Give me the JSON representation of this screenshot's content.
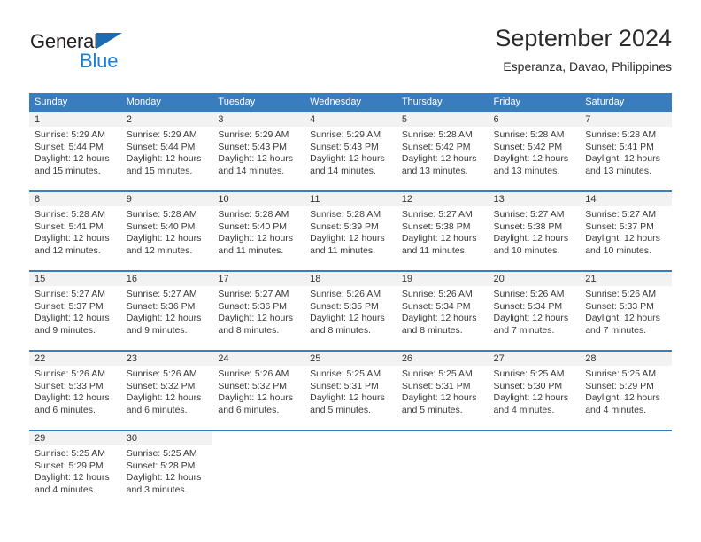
{
  "brand": {
    "name_top": "General",
    "name_bottom": "Blue",
    "color_dark": "#231f20",
    "color_blue": "#1b7fd4",
    "triangle_color": "#1b6cb5"
  },
  "header": {
    "title": "September 2024",
    "subtitle": "Esperanza, Davao, Philippines"
  },
  "theme": {
    "header_bg": "#3a7dbf",
    "header_text": "#ffffff",
    "daynum_bg": "#f2f2f2",
    "body_text": "#3a3a3a",
    "rule_color": "#3a7dbf"
  },
  "weekdays": [
    "Sunday",
    "Monday",
    "Tuesday",
    "Wednesday",
    "Thursday",
    "Friday",
    "Saturday"
  ],
  "labels": {
    "sunrise": "Sunrise:",
    "sunset": "Sunset:",
    "daylight": "Daylight:"
  },
  "weeks": [
    [
      {
        "day": "1",
        "sunrise": "Sunrise: 5:29 AM",
        "sunset": "Sunset: 5:44 PM",
        "daylight": "Daylight: 12 hours and 15 minutes."
      },
      {
        "day": "2",
        "sunrise": "Sunrise: 5:29 AM",
        "sunset": "Sunset: 5:44 PM",
        "daylight": "Daylight: 12 hours and 15 minutes."
      },
      {
        "day": "3",
        "sunrise": "Sunrise: 5:29 AM",
        "sunset": "Sunset: 5:43 PM",
        "daylight": "Daylight: 12 hours and 14 minutes."
      },
      {
        "day": "4",
        "sunrise": "Sunrise: 5:29 AM",
        "sunset": "Sunset: 5:43 PM",
        "daylight": "Daylight: 12 hours and 14 minutes."
      },
      {
        "day": "5",
        "sunrise": "Sunrise: 5:28 AM",
        "sunset": "Sunset: 5:42 PM",
        "daylight": "Daylight: 12 hours and 13 minutes."
      },
      {
        "day": "6",
        "sunrise": "Sunrise: 5:28 AM",
        "sunset": "Sunset: 5:42 PM",
        "daylight": "Daylight: 12 hours and 13 minutes."
      },
      {
        "day": "7",
        "sunrise": "Sunrise: 5:28 AM",
        "sunset": "Sunset: 5:41 PM",
        "daylight": "Daylight: 12 hours and 13 minutes."
      }
    ],
    [
      {
        "day": "8",
        "sunrise": "Sunrise: 5:28 AM",
        "sunset": "Sunset: 5:41 PM",
        "daylight": "Daylight: 12 hours and 12 minutes."
      },
      {
        "day": "9",
        "sunrise": "Sunrise: 5:28 AM",
        "sunset": "Sunset: 5:40 PM",
        "daylight": "Daylight: 12 hours and 12 minutes."
      },
      {
        "day": "10",
        "sunrise": "Sunrise: 5:28 AM",
        "sunset": "Sunset: 5:40 PM",
        "daylight": "Daylight: 12 hours and 11 minutes."
      },
      {
        "day": "11",
        "sunrise": "Sunrise: 5:28 AM",
        "sunset": "Sunset: 5:39 PM",
        "daylight": "Daylight: 12 hours and 11 minutes."
      },
      {
        "day": "12",
        "sunrise": "Sunrise: 5:27 AM",
        "sunset": "Sunset: 5:38 PM",
        "daylight": "Daylight: 12 hours and 11 minutes."
      },
      {
        "day": "13",
        "sunrise": "Sunrise: 5:27 AM",
        "sunset": "Sunset: 5:38 PM",
        "daylight": "Daylight: 12 hours and 10 minutes."
      },
      {
        "day": "14",
        "sunrise": "Sunrise: 5:27 AM",
        "sunset": "Sunset: 5:37 PM",
        "daylight": "Daylight: 12 hours and 10 minutes."
      }
    ],
    [
      {
        "day": "15",
        "sunrise": "Sunrise: 5:27 AM",
        "sunset": "Sunset: 5:37 PM",
        "daylight": "Daylight: 12 hours and 9 minutes."
      },
      {
        "day": "16",
        "sunrise": "Sunrise: 5:27 AM",
        "sunset": "Sunset: 5:36 PM",
        "daylight": "Daylight: 12 hours and 9 minutes."
      },
      {
        "day": "17",
        "sunrise": "Sunrise: 5:27 AM",
        "sunset": "Sunset: 5:36 PM",
        "daylight": "Daylight: 12 hours and 8 minutes."
      },
      {
        "day": "18",
        "sunrise": "Sunrise: 5:26 AM",
        "sunset": "Sunset: 5:35 PM",
        "daylight": "Daylight: 12 hours and 8 minutes."
      },
      {
        "day": "19",
        "sunrise": "Sunrise: 5:26 AM",
        "sunset": "Sunset: 5:34 PM",
        "daylight": "Daylight: 12 hours and 8 minutes."
      },
      {
        "day": "20",
        "sunrise": "Sunrise: 5:26 AM",
        "sunset": "Sunset: 5:34 PM",
        "daylight": "Daylight: 12 hours and 7 minutes."
      },
      {
        "day": "21",
        "sunrise": "Sunrise: 5:26 AM",
        "sunset": "Sunset: 5:33 PM",
        "daylight": "Daylight: 12 hours and 7 minutes."
      }
    ],
    [
      {
        "day": "22",
        "sunrise": "Sunrise: 5:26 AM",
        "sunset": "Sunset: 5:33 PM",
        "daylight": "Daylight: 12 hours and 6 minutes."
      },
      {
        "day": "23",
        "sunrise": "Sunrise: 5:26 AM",
        "sunset": "Sunset: 5:32 PM",
        "daylight": "Daylight: 12 hours and 6 minutes."
      },
      {
        "day": "24",
        "sunrise": "Sunrise: 5:26 AM",
        "sunset": "Sunset: 5:32 PM",
        "daylight": "Daylight: 12 hours and 6 minutes."
      },
      {
        "day": "25",
        "sunrise": "Sunrise: 5:25 AM",
        "sunset": "Sunset: 5:31 PM",
        "daylight": "Daylight: 12 hours and 5 minutes."
      },
      {
        "day": "26",
        "sunrise": "Sunrise: 5:25 AM",
        "sunset": "Sunset: 5:31 PM",
        "daylight": "Daylight: 12 hours and 5 minutes."
      },
      {
        "day": "27",
        "sunrise": "Sunrise: 5:25 AM",
        "sunset": "Sunset: 5:30 PM",
        "daylight": "Daylight: 12 hours and 4 minutes."
      },
      {
        "day": "28",
        "sunrise": "Sunrise: 5:25 AM",
        "sunset": "Sunset: 5:29 PM",
        "daylight": "Daylight: 12 hours and 4 minutes."
      }
    ],
    [
      {
        "day": "29",
        "sunrise": "Sunrise: 5:25 AM",
        "sunset": "Sunset: 5:29 PM",
        "daylight": "Daylight: 12 hours and 4 minutes."
      },
      {
        "day": "30",
        "sunrise": "Sunrise: 5:25 AM",
        "sunset": "Sunset: 5:28 PM",
        "daylight": "Daylight: 12 hours and 3 minutes."
      },
      {
        "day": "",
        "sunrise": "",
        "sunset": "",
        "daylight": ""
      },
      {
        "day": "",
        "sunrise": "",
        "sunset": "",
        "daylight": ""
      },
      {
        "day": "",
        "sunrise": "",
        "sunset": "",
        "daylight": ""
      },
      {
        "day": "",
        "sunrise": "",
        "sunset": "",
        "daylight": ""
      },
      {
        "day": "",
        "sunrise": "",
        "sunset": "",
        "daylight": ""
      }
    ]
  ]
}
